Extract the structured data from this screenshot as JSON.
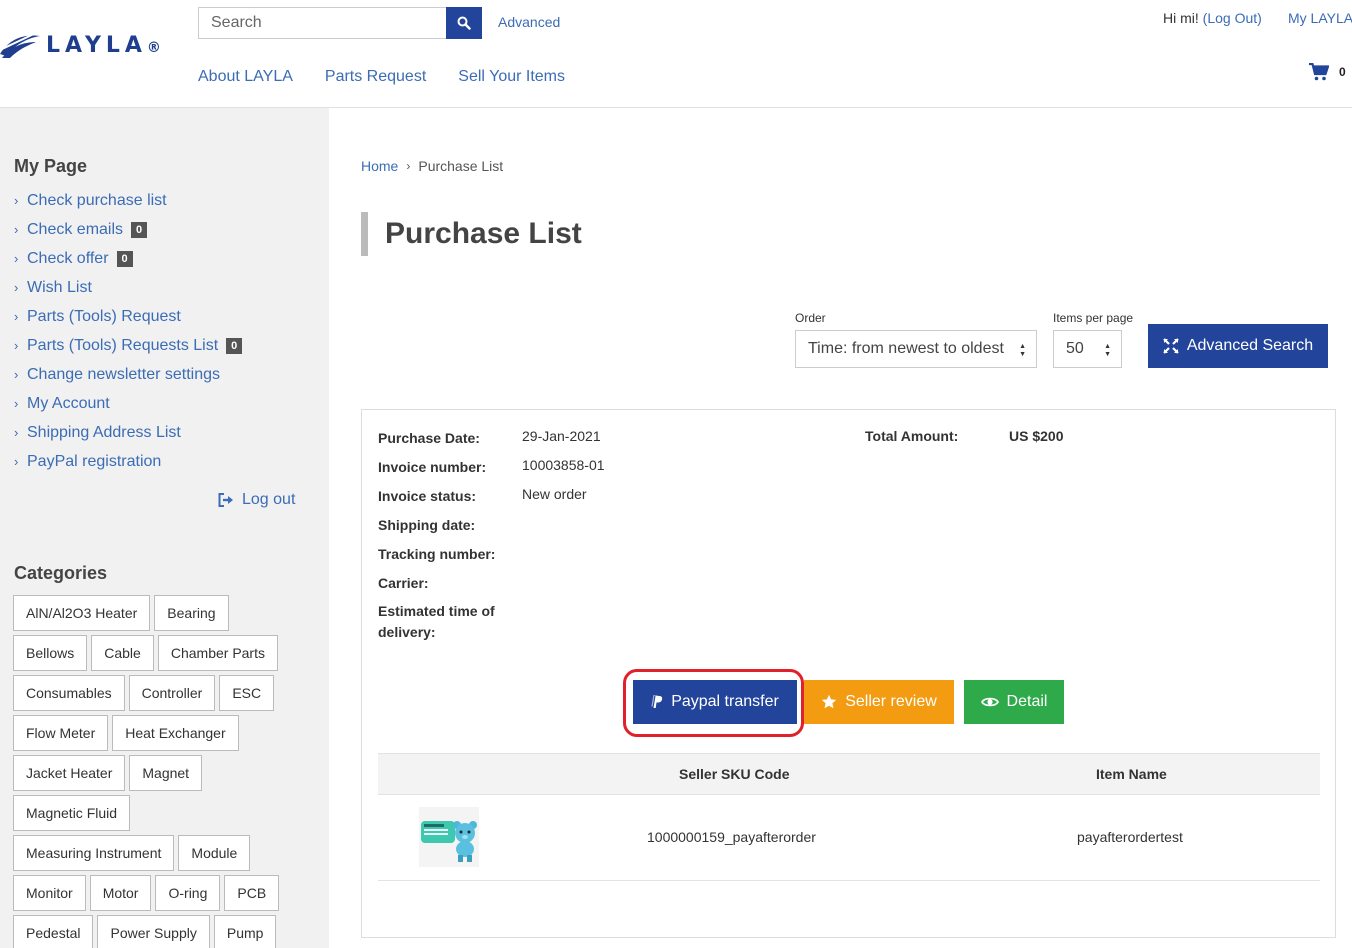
{
  "brand": {
    "name": "LAYLA",
    "reg": "®"
  },
  "header": {
    "search_placeholder": "Search",
    "advanced_link": "Advanced",
    "nav": [
      "About LAYLA",
      "Parts Request",
      "Sell Your Items"
    ],
    "greeting": "Hi mi!",
    "logout_link": "(Log Out)",
    "my_layla": "My LAYLA",
    "cart_count": "0"
  },
  "sidebar": {
    "title": "My Page",
    "items": [
      {
        "label": "Check purchase list",
        "badge": ""
      },
      {
        "label": "Check emails",
        "badge": "0"
      },
      {
        "label": "Check offer",
        "badge": "0"
      },
      {
        "label": "Wish List",
        "badge": ""
      },
      {
        "label": "Parts (Tools) Request",
        "badge": ""
      },
      {
        "label": "Parts (Tools) Requests List",
        "badge": "0"
      },
      {
        "label": "Change newsletter settings",
        "badge": ""
      },
      {
        "label": "My Account",
        "badge": ""
      },
      {
        "label": "Shipping Address List",
        "badge": ""
      },
      {
        "label": "PayPal registration",
        "badge": ""
      }
    ],
    "logout": "Log out",
    "categories_title": "Categories",
    "categories": [
      [
        "AlN/Al2O3 Heater",
        "Bearing"
      ],
      [
        "Bellows",
        "Cable",
        "Chamber Parts"
      ],
      [
        "Consumables",
        "Controller",
        "ESC"
      ],
      [
        "Flow Meter",
        "Heat Exchanger"
      ],
      [
        "Jacket Heater",
        "Magnet"
      ],
      [
        "Magnetic Fluid"
      ],
      [
        "Measuring Instrument",
        "Module"
      ],
      [
        "Monitor",
        "Motor",
        "O-ring",
        "PCB"
      ],
      [
        "Pedestal",
        "Power Supply",
        "Pump"
      ]
    ]
  },
  "main": {
    "breadcrumb": {
      "home": "Home",
      "current": "Purchase List"
    },
    "title": "Purchase List",
    "order_label": "Order",
    "order_value": "Time: from newest to oldest",
    "per_page_label": "Items per page",
    "per_page_value": "50",
    "advanced_search": "Advanced Search",
    "order_info": {
      "purchase_date_label": "Purchase Date:",
      "purchase_date": "29-Jan-2021",
      "invoice_number_label": "Invoice number:",
      "invoice_number": "10003858-01",
      "invoice_status_label": "Invoice status:",
      "invoice_status": "New order",
      "shipping_date_label": "Shipping date:",
      "tracking_number_label": "Tracking number:",
      "carrier_label": "Carrier:",
      "eta_label": "Estimated time of delivery:",
      "total_label": "Total Amount:",
      "total": "US $200"
    },
    "buttons": {
      "paypal": "Paypal transfer",
      "review": "Seller review",
      "detail": "Detail"
    },
    "table": {
      "headers": [
        "Seller SKU Code",
        "Item Name"
      ],
      "rows": [
        {
          "sku": "1000000159_payafterorder",
          "name": "payafterordertest"
        }
      ]
    }
  },
  "colors": {
    "primary": "#23449b",
    "link": "#3b6cb5",
    "review": "#f39c12",
    "detail": "#2eaa4a",
    "highlight": "#e0202a"
  }
}
